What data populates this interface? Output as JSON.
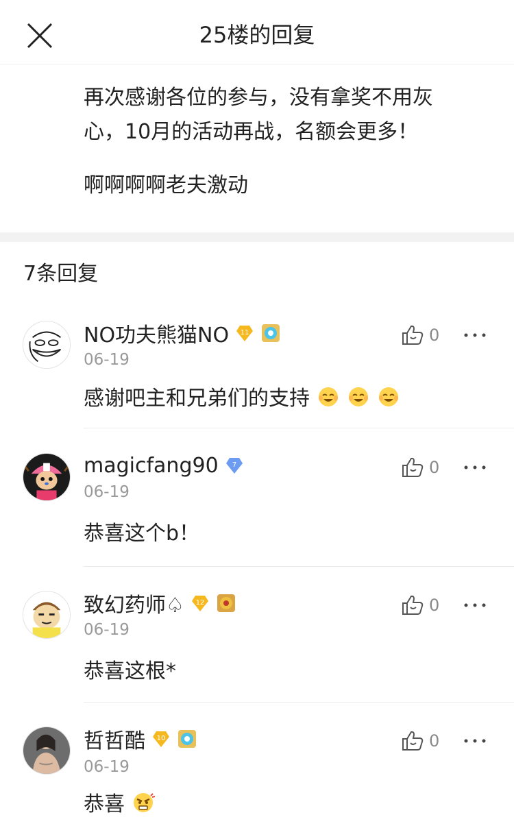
{
  "header": {
    "title": "25楼的回复",
    "close_icon": "close-icon"
  },
  "post": {
    "paragraph1_line1": "再次感谢各位的参与，没有拿奖不用灰",
    "paragraph1_line2": "心，10月的活动再战，名额会更多！",
    "paragraph2": "啊啊啊啊老夫激动"
  },
  "replies_header": {
    "count_label": "7条回复"
  },
  "replies": [
    {
      "username": "NO功夫熊猫NO",
      "level": "11",
      "level_color": "#f5b81e",
      "date": "06-19",
      "content": "感谢吧主和兄弟们的支持",
      "emoji": "laughing-emoji",
      "emoji_count": 3,
      "likes": "0",
      "avatar": "trollface-avatar"
    },
    {
      "username": "magicfang90",
      "level": "7",
      "level_color": "#6c9cf2",
      "date": "06-19",
      "content": "恭喜这个b！",
      "emoji": "",
      "emoji_count": 0,
      "likes": "0",
      "avatar": "chopper-avatar"
    },
    {
      "username": "致幻药师♤",
      "level": "12",
      "level_color": "#f5b81e",
      "date": "06-19",
      "content": "恭喜这根*",
      "emoji": "",
      "emoji_count": 0,
      "likes": "0",
      "avatar": "cartoon-face-avatar"
    },
    {
      "username": "哲哲酷",
      "level": "10",
      "level_color": "#f5b81e",
      "date": "06-19",
      "content": "恭喜",
      "emoji": "angry-emoji",
      "emoji_count": 1,
      "likes": "0",
      "avatar": "photo-avatar"
    }
  ]
}
